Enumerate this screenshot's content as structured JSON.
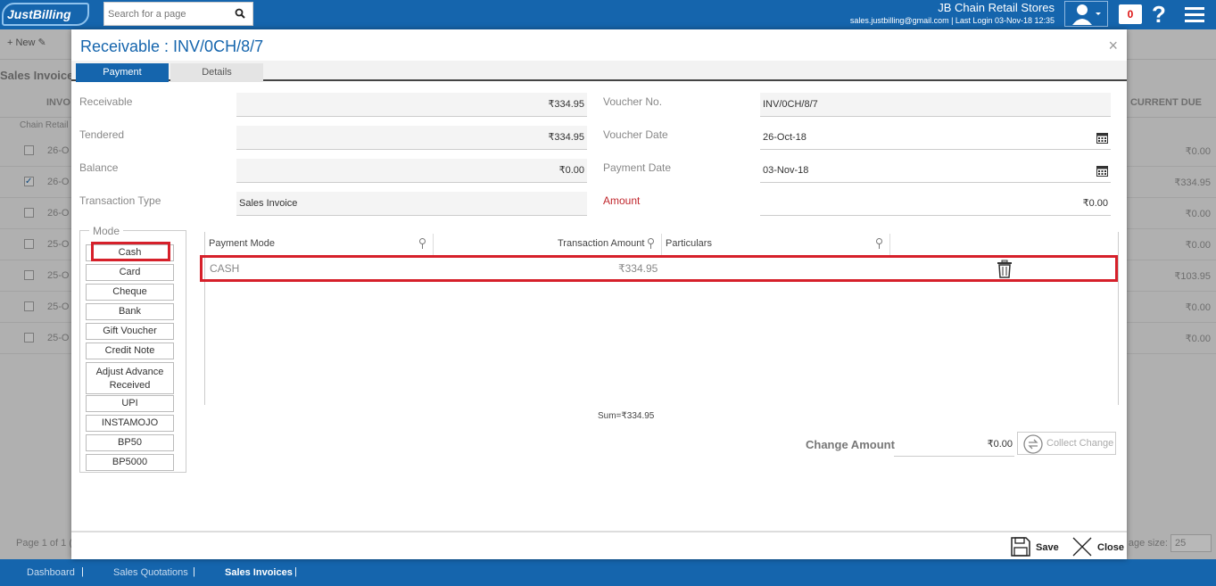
{
  "topbar": {
    "logo": "JustBilling",
    "search_placeholder": "Search for a page",
    "company_name": "JB Chain Retail Stores",
    "company_meta": "sales.justbilling@gmail.com | Last Login 03-Nov-18 12:35",
    "notifications": "0",
    "help": "?"
  },
  "background": {
    "new_label": "New",
    "title": "Sales Invoices",
    "col_invoice": "INVO",
    "col_current_due": "CURRENT DUE",
    "group_label": "Chain Retail",
    "rows": [
      {
        "date": "26-O",
        "due": "₹0.00",
        "checked": false
      },
      {
        "date": "26-O",
        "due": "₹334.95",
        "checked": true
      },
      {
        "date": "26-O",
        "due": "₹0.00",
        "checked": false
      },
      {
        "date": "25-O",
        "due": "₹0.00",
        "checked": false
      },
      {
        "date": "25-O",
        "due": "₹103.95",
        "checked": false
      },
      {
        "date": "25-O",
        "due": "₹0.00",
        "checked": false
      },
      {
        "date": "25-O",
        "due": "₹0.00",
        "checked": false
      }
    ],
    "page_info": "Page 1 of 1 (",
    "page_size_label": "age size:",
    "page_size_value": "25"
  },
  "bottombar": {
    "dashboard": "Dashboard",
    "sales_quotations": "Sales Quotations",
    "sales_invoices": "Sales Invoices"
  },
  "modal": {
    "title": "Receivable : INV/0CH/8/7",
    "close": "×",
    "tabs": {
      "payment": "Payment",
      "details": "Details"
    },
    "left": {
      "receivable_label": "Receivable",
      "receivable_value": "₹334.95",
      "tendered_label": "Tendered",
      "tendered_value": "₹334.95",
      "balance_label": "Balance",
      "balance_value": "₹0.00",
      "transaction_type_label": "Transaction Type",
      "transaction_type_value": "Sales Invoice"
    },
    "right": {
      "voucher_no_label": "Voucher No.",
      "voucher_no_value": "INV/0CH/8/7",
      "voucher_date_label": "Voucher Date",
      "voucher_date_value": "26-Oct-18",
      "payment_date_label": "Payment Date",
      "payment_date_value": "03-Nov-18",
      "amount_label": "Amount",
      "amount_value": "₹0.00"
    },
    "mode": {
      "legend": "Mode",
      "buttons": [
        "Cash",
        "Card",
        "Cheque",
        "Bank",
        "Gift Voucher",
        "Credit Note",
        "Adjust Advance Received",
        "UPI",
        "INSTAMOJO",
        "BP50",
        "BP5000"
      ]
    },
    "grid": {
      "col_payment_mode": "Payment Mode",
      "col_transaction_amount": "Transaction Amount",
      "col_particulars": "Particulars",
      "row_mode": "CASH",
      "row_amount": "₹334.95",
      "sum": "Sum=₹334.95"
    },
    "change": {
      "label": "Change Amount",
      "value": "₹0.00",
      "collect_button": "Collect Change"
    },
    "footer": {
      "save": "Save",
      "close": "Close"
    }
  },
  "colors": {
    "brand": "#1565ad",
    "highlight": "#d6202a",
    "amount_label": "#c0272d"
  }
}
